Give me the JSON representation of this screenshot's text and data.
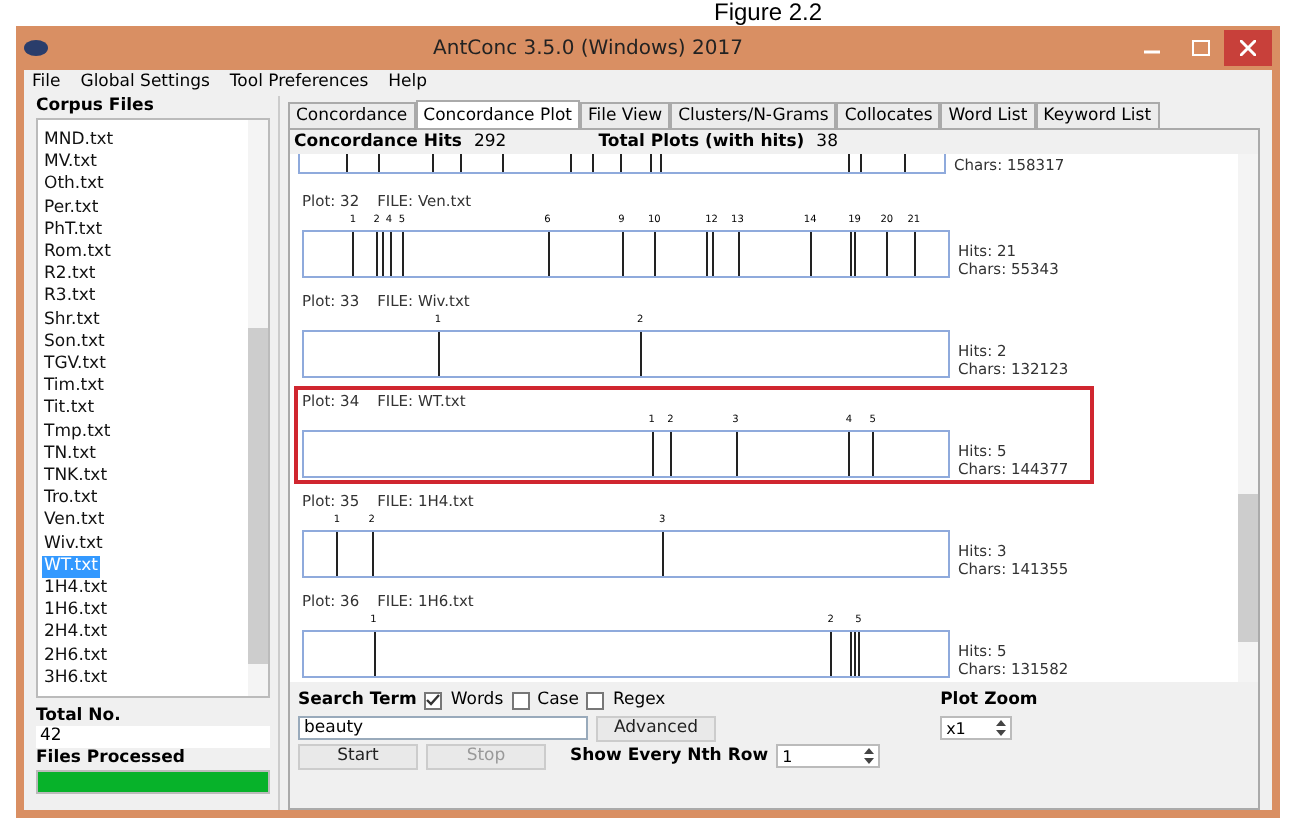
{
  "caption": "Figure 2.2",
  "window": {
    "title": "AntConc 3.5.0 (Windows) 2017"
  },
  "menu": [
    "File",
    "Global Settings",
    "Tool Preferences",
    "Help"
  ],
  "corpus": {
    "heading": "Corpus Files",
    "files": [
      {
        "name": "MND.txt",
        "selected": false
      },
      {
        "name": "MV.txt",
        "selected": false
      },
      {
        "name": "Oth.txt",
        "selected": false
      },
      {
        "name": "Per.txt",
        "selected": false
      },
      {
        "name": "PhT.txt",
        "selected": false
      },
      {
        "name": "Rom.txt",
        "selected": false
      },
      {
        "name": "R2.txt",
        "selected": false
      },
      {
        "name": "R3.txt",
        "selected": false
      },
      {
        "name": "Shr.txt",
        "selected": false
      },
      {
        "name": "Son.txt",
        "selected": false
      },
      {
        "name": "TGV.txt",
        "selected": false
      },
      {
        "name": "Tim.txt",
        "selected": false
      },
      {
        "name": "Tit.txt",
        "selected": false
      },
      {
        "name": "Tmp.txt",
        "selected": false
      },
      {
        "name": "TN.txt",
        "selected": false
      },
      {
        "name": "TNK.txt",
        "selected": false
      },
      {
        "name": "Tro.txt",
        "selected": false
      },
      {
        "name": "Ven.txt",
        "selected": false
      },
      {
        "name": "Wiv.txt",
        "selected": false
      },
      {
        "name": "WT.txt",
        "selected": true
      },
      {
        "name": "1H4.txt",
        "selected": false
      },
      {
        "name": "1H6.txt",
        "selected": false
      },
      {
        "name": "2H4.txt",
        "selected": false
      },
      {
        "name": "2H6.txt",
        "selected": false
      },
      {
        "name": "3H6.txt",
        "selected": false
      }
    ],
    "total_label": "Total No.",
    "total": "42",
    "processed": {
      "label": "Files Processed",
      "level": 1
    }
  },
  "tabs": [
    {
      "label": "Concordance",
      "selected": false
    },
    {
      "label": "Concordance Plot",
      "selected": true
    },
    {
      "label": "File View",
      "selected": false
    },
    {
      "label": "Clusters/N-Grams",
      "selected": false
    },
    {
      "label": "Collocates",
      "selected": false
    },
    {
      "label": "Word List",
      "selected": false
    },
    {
      "label": "Keyword List",
      "selected": false
    }
  ],
  "summary": {
    "hits_label": "Concordance Hits",
    "hits": "292",
    "plots_label": "Total Plots (with hits)",
    "plots": "38"
  },
  "partial_plot": {
    "chars": "Chars: 158317",
    "marks": [
      {
        "level": 0.072
      },
      {
        "level": 0.12
      },
      {
        "level": 0.206
      },
      {
        "level": 0.247
      },
      {
        "level": 0.313
      },
      {
        "level": 0.419
      },
      {
        "level": 0.453
      },
      {
        "level": 0.496
      },
      {
        "level": 0.542
      },
      {
        "level": 0.558
      },
      {
        "level": 0.851
      },
      {
        "level": 0.871
      },
      {
        "level": 0.938
      }
    ]
  },
  "plots": [
    {
      "plot": "Plot: 32",
      "file": "FILE: Ven.txt",
      "hits": "Hits: 21",
      "chars": "Chars: 55343",
      "highlighted": false,
      "marks": [
        {
          "label": "1",
          "level": 0.076
        },
        {
          "label": "2",
          "level": 0.113
        },
        {
          "level": 0.121
        },
        {
          "label": "4",
          "level": 0.132
        },
        {
          "label": "5",
          "level": 0.152
        },
        {
          "label": "6",
          "level": 0.378
        },
        {
          "label": "9",
          "level": 0.493
        },
        {
          "label": "10",
          "level": 0.544
        },
        {
          "level": 0.625
        },
        {
          "label": "12",
          "level": 0.633
        },
        {
          "label": "13",
          "level": 0.673
        },
        {
          "label": "14",
          "level": 0.786
        },
        {
          "level": 0.847
        },
        {
          "label": "19",
          "level": 0.855
        },
        {
          "label": "20",
          "level": 0.905
        },
        {
          "label": "21",
          "level": 0.947
        }
      ]
    },
    {
      "plot": "Plot: 33",
      "file": "FILE: Wiv.txt",
      "hits": "Hits: 2",
      "chars": "Chars: 132123",
      "highlighted": false,
      "marks": [
        {
          "label": "1",
          "level": 0.208
        },
        {
          "label": "2",
          "level": 0.522
        }
      ]
    },
    {
      "plot": "Plot: 34",
      "file": "FILE: WT.txt",
      "hits": "Hits: 5",
      "chars": "Chars: 144377",
      "highlighted": true,
      "marks": [
        {
          "label": "1",
          "level": 0.54
        },
        {
          "label": "2",
          "level": 0.569
        },
        {
          "label": "3",
          "level": 0.67
        },
        {
          "label": "4",
          "level": 0.846
        },
        {
          "label": "5",
          "level": 0.883
        }
      ]
    },
    {
      "plot": "Plot: 35",
      "file": "FILE: 1H4.txt",
      "hits": "Hits: 3",
      "chars": "Chars: 141355",
      "highlighted": false,
      "marks": [
        {
          "label": "1",
          "level": 0.051
        },
        {
          "label": "2",
          "level": 0.105
        },
        {
          "label": "3",
          "level": 0.556
        }
      ]
    },
    {
      "plot": "Plot: 36",
      "file": "FILE: 1H6.txt",
      "hits": "Hits: 5",
      "chars": "Chars: 131582",
      "highlighted": false,
      "marks": [
        {
          "label": "1",
          "level": 0.108
        },
        {
          "label": "2",
          "level": 0.818
        },
        {
          "level": 0.849
        },
        {
          "level": 0.855
        },
        {
          "label": "5",
          "level": 0.861
        }
      ]
    }
  ],
  "search": {
    "label": "Search Term",
    "options": [
      {
        "label": "Words",
        "checked": true
      },
      {
        "label": "Case",
        "checked": false
      },
      {
        "label": "Regex",
        "checked": false
      }
    ],
    "value": "beauty",
    "advanced": "Advanced",
    "start": "Start",
    "stop": "Stop",
    "stop_disabled": true,
    "nth_label": "Show Every Nth Row",
    "nth": "1"
  },
  "zoom": {
    "label": "Plot Zoom",
    "value": "x1"
  }
}
